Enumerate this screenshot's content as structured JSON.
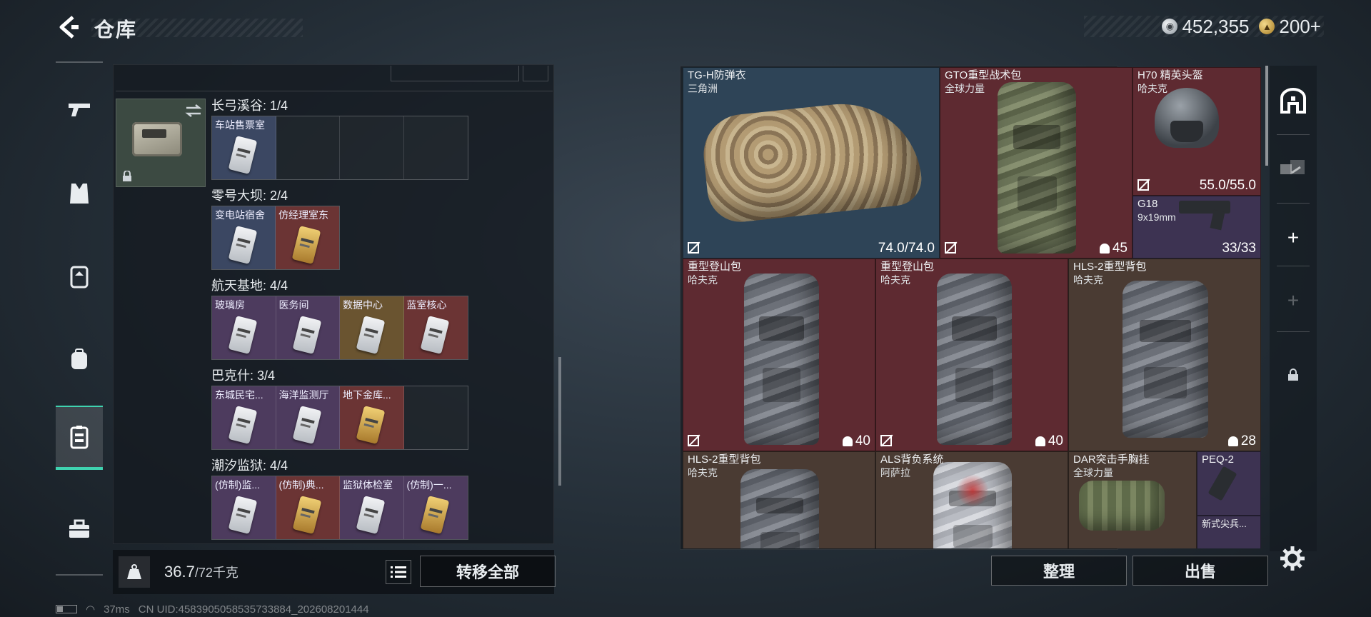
{
  "header": {
    "title": "仓库",
    "currency": [
      {
        "icon": "silver-coin-icon",
        "value": "452,355"
      },
      {
        "icon": "gold-coin-icon",
        "value": "200+"
      }
    ]
  },
  "left_nav": {
    "items": [
      {
        "icon": "gun-icon"
      },
      {
        "icon": "vest-icon"
      },
      {
        "icon": "chest-rig-icon"
      },
      {
        "icon": "backpack-icon"
      },
      {
        "icon": "key-case-icon",
        "active": true
      },
      {
        "icon": "toolbox-icon"
      }
    ]
  },
  "key_case": {
    "regions": [
      {
        "label": "长弓溪谷: 1/4",
        "slots": [
          {
            "name": "车站售票室",
            "color": "blue",
            "card": "silver"
          },
          {
            "name": "",
            "color": "empty"
          },
          {
            "name": "",
            "color": "empty"
          },
          {
            "name": "",
            "color": "empty"
          }
        ]
      },
      {
        "label": "零号大坝: 2/4",
        "slots": [
          {
            "name": "变电站宿舍",
            "color": "blue",
            "card": "silver"
          },
          {
            "name": "仿经理室东",
            "color": "red",
            "card": "gold"
          }
        ]
      },
      {
        "label": "航天基地: 4/4",
        "slots": [
          {
            "name": "玻璃房",
            "color": "purple",
            "card": "silver"
          },
          {
            "name": "医务间",
            "color": "purple",
            "card": "silver"
          },
          {
            "name": "数据中心",
            "color": "gold",
            "card": "silver"
          },
          {
            "name": "蓝室核心",
            "color": "red",
            "card": "silver"
          }
        ]
      },
      {
        "label": "巴克什: 3/4",
        "slots": [
          {
            "name": "东城民宅...",
            "color": "purple",
            "card": "silver"
          },
          {
            "name": "海洋监测厅",
            "color": "purple",
            "card": "silver"
          },
          {
            "name": "地下金库...",
            "color": "red",
            "card": "gold"
          },
          {
            "name": "",
            "color": "empty"
          }
        ]
      },
      {
        "label": "潮汐监狱: 4/4",
        "slots": [
          {
            "name": "(仿制)监...",
            "color": "purple",
            "card": "silver"
          },
          {
            "name": "(仿制)典...",
            "color": "red",
            "card": "gold"
          },
          {
            "name": "监狱体检室",
            "color": "purple",
            "card": "silver"
          },
          {
            "name": "(仿制)一...",
            "color": "purple",
            "card": "gold"
          }
        ]
      }
    ]
  },
  "weight": {
    "current": "36.7",
    "max": "/72千克"
  },
  "transfer_all_label": "转移全部",
  "stash_items": [
    {
      "name": "TG-H防弹衣",
      "sub": "三角洲",
      "value": "74.0/74.0",
      "nodur": true,
      "color": "blue"
    },
    {
      "name": "GTO重型战术包",
      "sub": "全球力量",
      "value": "45",
      "nodur": true,
      "lock": true,
      "color": "red"
    },
    {
      "name": "H70 精英头盔",
      "sub": "哈夫克",
      "value": "55.0/55.0",
      "nodur": true,
      "color": "red"
    },
    {
      "name": "G18",
      "sub": "9x19mm",
      "value": "33/33",
      "color": "purple"
    },
    {
      "name": "重型登山包",
      "sub": "哈夫克",
      "value": "40",
      "nodur": true,
      "lock": true,
      "color": "red"
    },
    {
      "name": "重型登山包",
      "sub": "哈夫克",
      "value": "40",
      "nodur": true,
      "lock": true,
      "color": "red"
    },
    {
      "name": "HLS-2重型背包",
      "sub": "哈夫克",
      "value": "28",
      "lock": true,
      "color": "brown"
    },
    {
      "name": "HLS-2重型背包",
      "sub": "哈夫克",
      "value": "",
      "color": "brown"
    },
    {
      "name": "ALS背负系统",
      "sub": "阿萨拉",
      "value": "",
      "color": "brown"
    },
    {
      "name": "DAR突击手胸挂",
      "sub": "全球力量",
      "value": "",
      "color": "brown"
    },
    {
      "name": "PEQ-2",
      "sub": "",
      "value": "",
      "color": "purple"
    },
    {
      "name": "新式尖兵...",
      "sub": "",
      "value": "",
      "color": "purple"
    }
  ],
  "right_nav": {
    "items": [
      {
        "icon": "stash-icon"
      },
      {
        "icon": "transfer-icon"
      },
      {
        "icon": "plus-icon"
      },
      {
        "icon": "plus-icon"
      },
      {
        "icon": "lock-icon"
      }
    ]
  },
  "actions": {
    "tidy": "整理",
    "sell": "出售"
  },
  "status": {
    "ping": "37ms",
    "uid": "CN UID:4583905058535733884_202608201444"
  }
}
